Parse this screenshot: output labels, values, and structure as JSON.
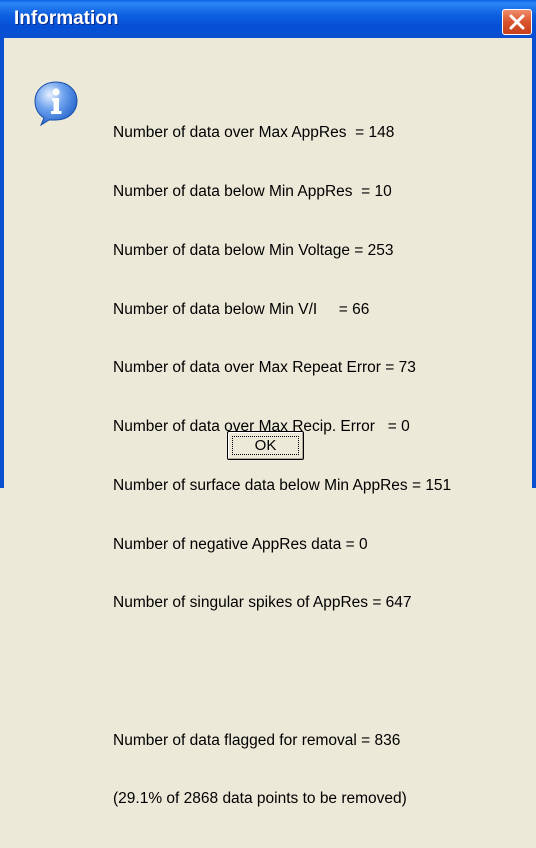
{
  "window": {
    "title": "Information"
  },
  "colors": {
    "titlebar": "#0A5FE6",
    "close_button": "#D9542C",
    "face": "#ECE9D8",
    "info_icon": "#1E5FC8"
  },
  "icons": {
    "dialog_icon": "information-icon",
    "close": "close-icon"
  },
  "message": {
    "lines": [
      "Number of data over Max AppRes  = 148",
      "Number of data below Min AppRes  = 10",
      "Number of data below Min Voltage = 253",
      "Number of data below Min V/I     = 66",
      "Number of data over Max Repeat Error = 73",
      "Number of data over Max Recip. Error   = 0",
      "Number of surface data below Min AppRes = 151",
      "Number of negative AppRes data = 0",
      "Number of singular spikes of AppRes = 647"
    ],
    "summary": [
      "Number of data flagged for removal = 836",
      "(29.1% of 2868 data points to be removed)"
    ]
  },
  "buttons": {
    "ok_label": "OK"
  }
}
